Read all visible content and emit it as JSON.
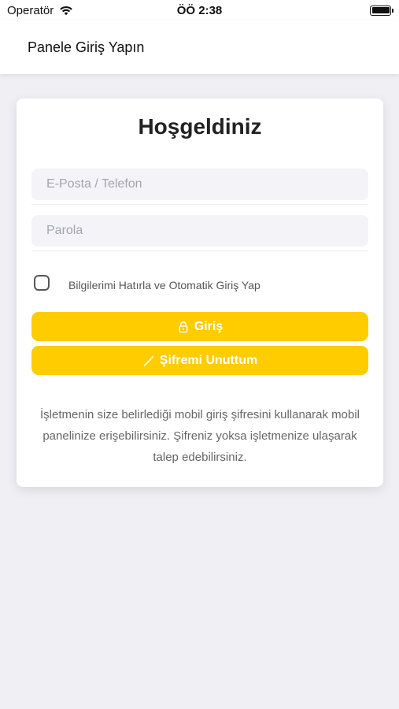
{
  "status_bar": {
    "carrier": "Operatör",
    "time": "ÖÖ 2:38"
  },
  "nav": {
    "title": "Panele Giriş Yapın"
  },
  "login": {
    "title": "Hoşgeldiniz",
    "email_placeholder": "E-Posta / Telefon",
    "email_value": "",
    "password_placeholder": "Parola",
    "password_value": "",
    "remember_label": "Bilgilerimi Hatırla ve Otomatik Giriş Yap",
    "remember_checked": false,
    "login_button": "Giriş",
    "forgot_button": "Şifremi Unuttum",
    "info_text": "İşletmenin size belirlediği mobil giriş şifresini kullanarak mobil panelinize erişebilirsiniz. Şifreniz yoksa işletmenize ulaşarak talep edebilirsiniz."
  },
  "colors": {
    "accent": "#ffcc00",
    "background": "#efeff4",
    "field_background": "#f3f3f8"
  },
  "icons": {
    "wifi": "wifi-icon",
    "battery": "battery-icon",
    "login": "lock-icon",
    "forgot": "magic-wand-icon"
  }
}
